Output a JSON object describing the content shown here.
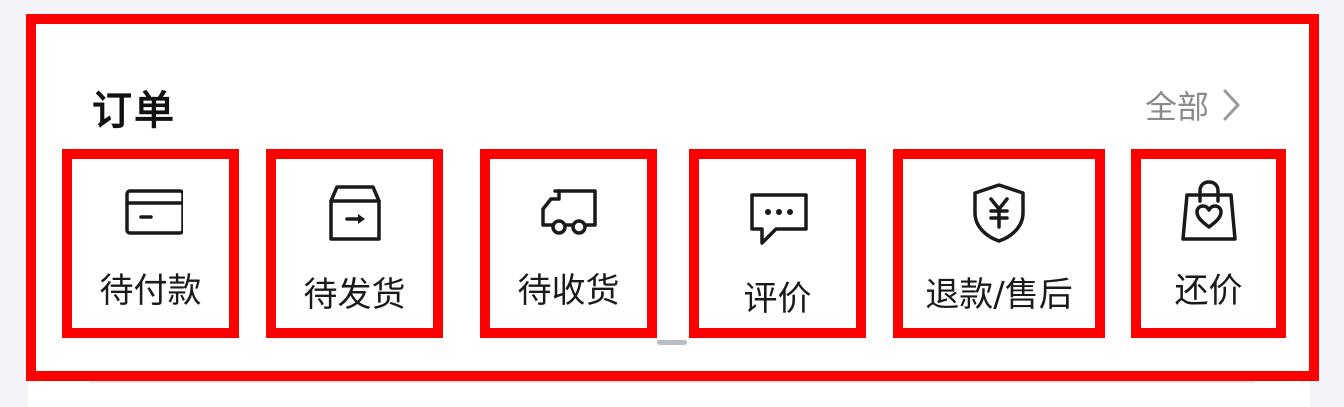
{
  "orders": {
    "title": "订单",
    "all_label": "全部",
    "items": [
      {
        "label": "待付款",
        "icon": "card-icon"
      },
      {
        "label": "待发货",
        "icon": "box-icon"
      },
      {
        "label": "待收货",
        "icon": "truck-icon"
      },
      {
        "label": "评价",
        "icon": "comment-icon"
      },
      {
        "label": "退款/售后",
        "icon": "shield-yen-icon"
      },
      {
        "label": "还价",
        "icon": "bag-heart-icon"
      }
    ]
  },
  "colors": {
    "accent_outline": "#ff0000",
    "text": "#1a1a1a",
    "muted": "#8a8a8e",
    "background": "#f3f3f8"
  }
}
